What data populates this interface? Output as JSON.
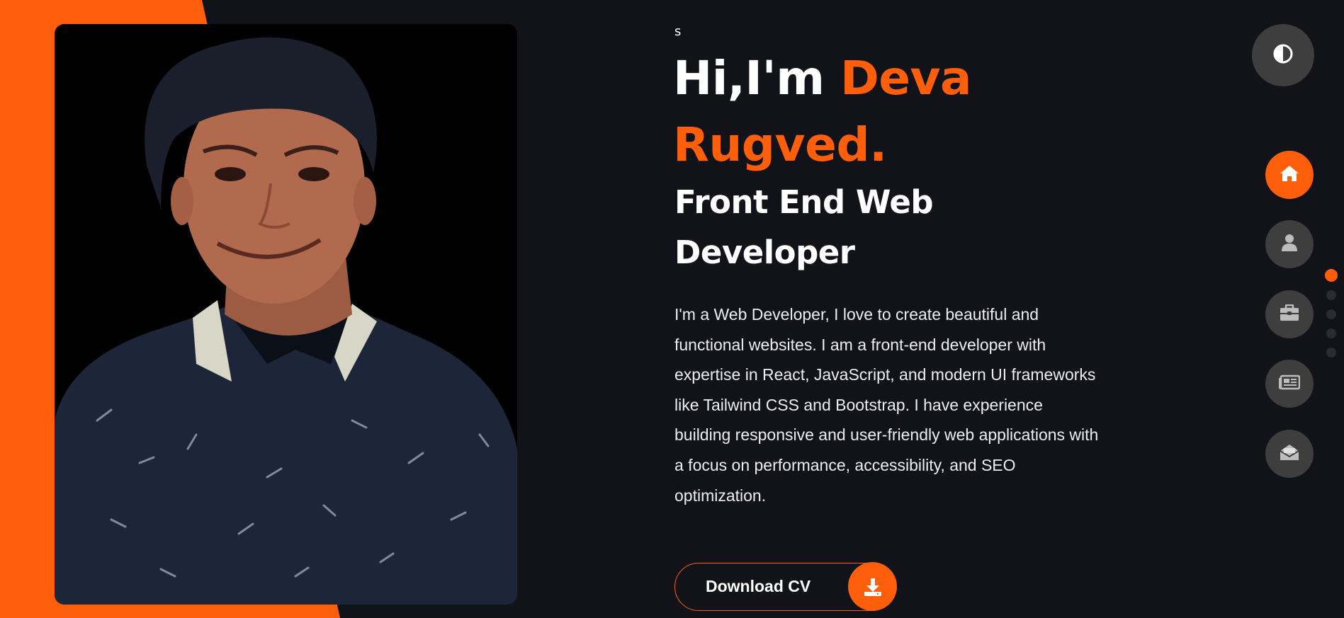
{
  "hero": {
    "small_text": "s",
    "greeting": "Hi,I'm",
    "name_part1": "Deva",
    "name_part2": "Rugved.",
    "role_line1": "Front End Web",
    "role_line2": "Developer",
    "about": "I'm a Web Developer, I love to create beautiful and functional websites. I am a front-end developer with expertise in React, JavaScript, and modern UI frameworks like Tailwind CSS and Bootstrap. I have experience building responsive and user-friendly web applications with a focus on performance, accessibility, and SEO optimization.",
    "cta_label": "Download CV"
  },
  "colors": {
    "accent": "#ff5e0a",
    "background": "#111319",
    "button_gray": "#3e3e3e"
  },
  "side_nav": {
    "theme_toggle_icon": "contrast-icon",
    "items": [
      {
        "icon": "home-icon",
        "active": true
      },
      {
        "icon": "user-icon",
        "active": false
      },
      {
        "icon": "briefcase-icon",
        "active": false
      },
      {
        "icon": "newspaper-icon",
        "active": false
      },
      {
        "icon": "envelope-open-icon",
        "active": false
      }
    ]
  },
  "section_dots": {
    "count": 5,
    "active_index": 0
  }
}
